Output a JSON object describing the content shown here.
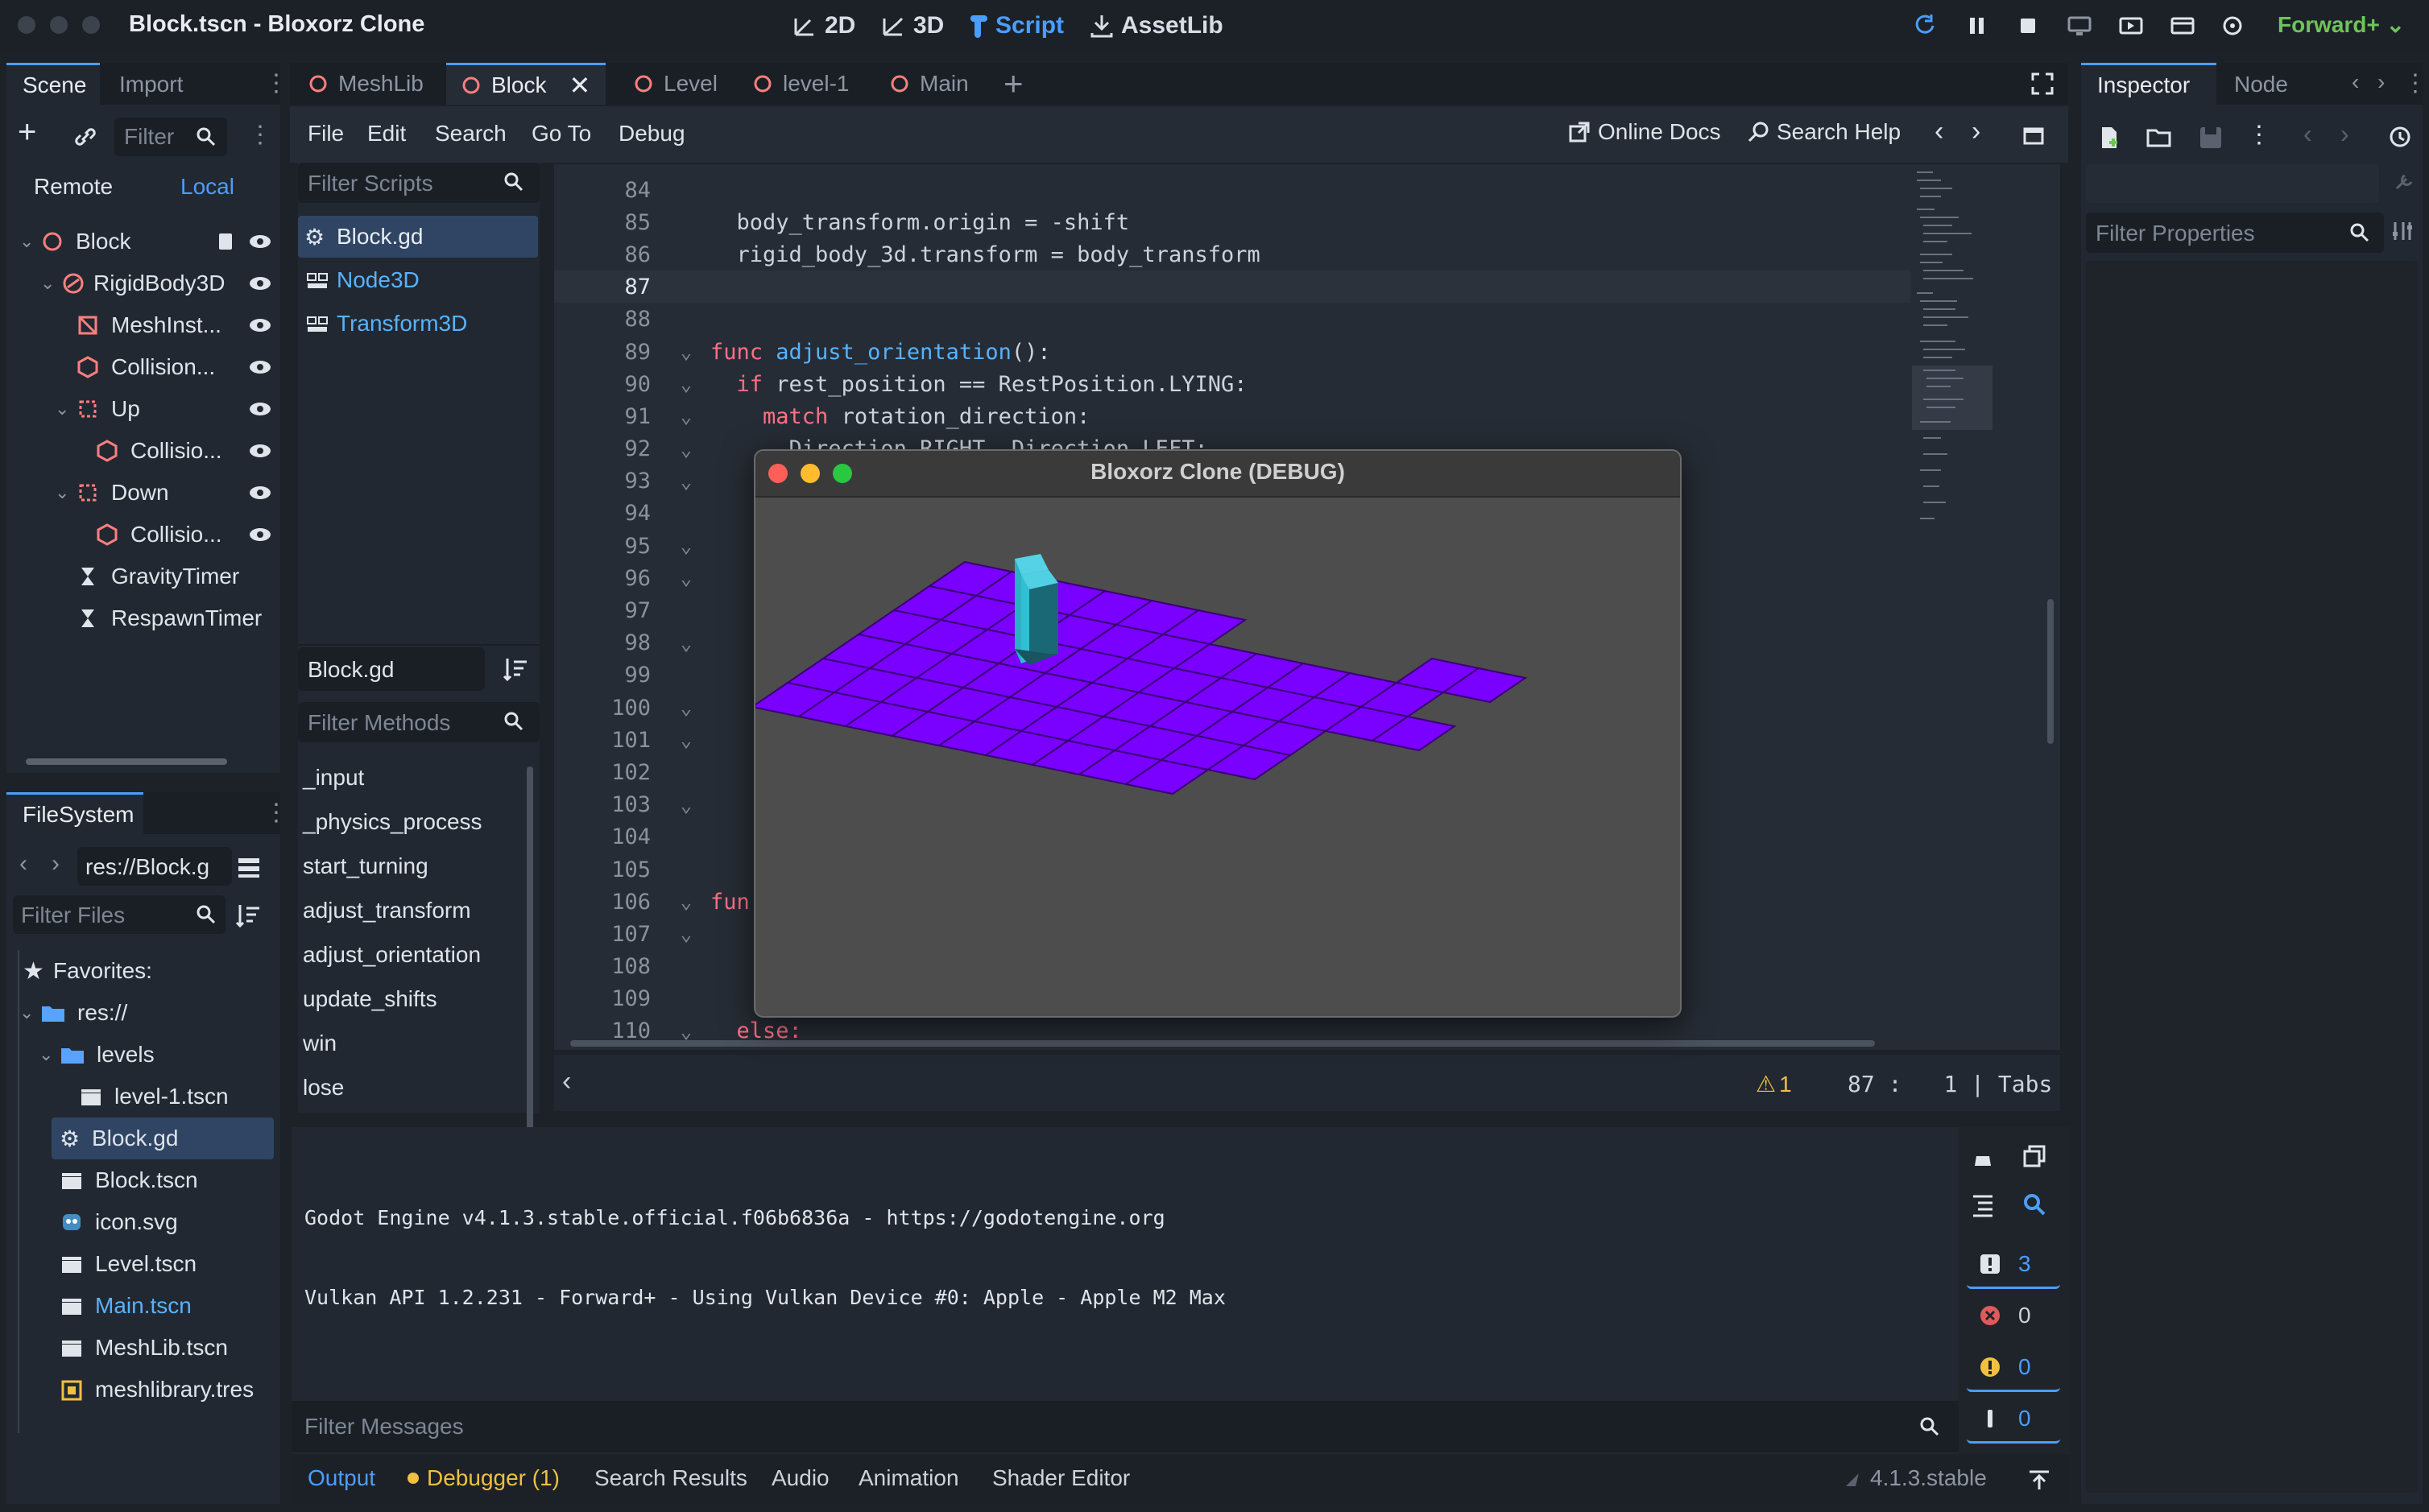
{
  "window": {
    "title": "Block.tscn - Bloxorz Clone"
  },
  "modes": [
    {
      "label": "2D",
      "icon": "2d-icon"
    },
    {
      "label": "3D",
      "icon": "3d-icon"
    },
    {
      "label": "Script",
      "icon": "script-icon"
    },
    {
      "label": "AssetLib",
      "icon": "assetlib-icon"
    }
  ],
  "renderer": "Forward+",
  "scene_dock": {
    "tabs": [
      "Scene",
      "Import"
    ],
    "filter_placeholder": "Filter",
    "remote": "Remote",
    "local": "Local",
    "nodes": [
      {
        "label": "Block",
        "depth": 0,
        "icon": "node3d-icon"
      },
      {
        "label": "RigidBody3D",
        "depth": 1,
        "icon": "rigidbody-icon"
      },
      {
        "label": "MeshInst...",
        "depth": 2,
        "icon": "mesh-icon"
      },
      {
        "label": "Collision...",
        "depth": 2,
        "icon": "collision-icon"
      },
      {
        "label": "Up",
        "depth": 2,
        "icon": "area-icon"
      },
      {
        "label": "Collisio...",
        "depth": 3,
        "icon": "collision-icon"
      },
      {
        "label": "Down",
        "depth": 2,
        "icon": "area-icon"
      },
      {
        "label": "Collisio...",
        "depth": 3,
        "icon": "collision-icon"
      },
      {
        "label": "GravityTimer",
        "depth": 1,
        "icon": "timer-icon"
      },
      {
        "label": "RespawnTimer",
        "depth": 1,
        "icon": "timer-icon"
      }
    ]
  },
  "filesystem": {
    "title": "FileSystem",
    "path": "res://Block.g",
    "filter_placeholder": "Filter Files",
    "items": [
      {
        "label": "Favorites:",
        "icon": "star-icon",
        "depth": 0
      },
      {
        "label": "res://",
        "icon": "folder-icon",
        "depth": 0
      },
      {
        "label": "levels",
        "icon": "folder-icon",
        "depth": 1
      },
      {
        "label": "level-1.tscn",
        "icon": "scene-icon",
        "depth": 2
      },
      {
        "label": "Block.gd",
        "icon": "gear-icon",
        "depth": 1,
        "selected": true
      },
      {
        "label": "Block.tscn",
        "icon": "scene-icon",
        "depth": 1
      },
      {
        "label": "icon.svg",
        "icon": "godot-icon",
        "depth": 1
      },
      {
        "label": "Level.tscn",
        "icon": "scene-icon",
        "depth": 1
      },
      {
        "label": "Main.tscn",
        "icon": "scene-icon",
        "depth": 1,
        "highlight": true
      },
      {
        "label": "MeshLib.tscn",
        "icon": "scene-icon",
        "depth": 1
      },
      {
        "label": "meshlibrary.tres",
        "icon": "resource-icon",
        "depth": 1
      }
    ]
  },
  "scene_tabs": [
    "MeshLib",
    "Block",
    "Level",
    "level-1",
    "Main"
  ],
  "script_menu": [
    "File",
    "Edit",
    "Search",
    "Go To",
    "Debug"
  ],
  "online_docs": "Online Docs",
  "search_help": "Search Help",
  "scripts_panel": {
    "filter_placeholder": "Filter Scripts",
    "scripts": [
      "Block.gd",
      "Node3D",
      "Transform3D"
    ],
    "current": "Block.gd",
    "methods_placeholder": "Filter Methods",
    "methods": [
      "_input",
      "_physics_process",
      "start_turning",
      "adjust_transform",
      "adjust_orientation",
      "update_shifts",
      "win",
      "lose"
    ]
  },
  "code": {
    "lines": [
      {
        "n": "84",
        "t": ""
      },
      {
        "n": "85",
        "t": "  body_transform.origin = -shift"
      },
      {
        "n": "86",
        "t": "  rigid_body_3d.transform = body_transform"
      },
      {
        "n": "87",
        "t": ""
      },
      {
        "n": "88",
        "t": ""
      },
      {
        "n": "89",
        "t": "func adjust_orientation():"
      },
      {
        "n": "90",
        "t": "  if rest_position == RestPosition.LYING:"
      },
      {
        "n": "91",
        "t": "    match rotation_direction:"
      },
      {
        "n": "92",
        "t": "      Direction.RIGHT, Direction.LEFT:"
      },
      {
        "n": "93",
        "t": ""
      },
      {
        "n": "94",
        "t": ""
      },
      {
        "n": "95",
        "t": ""
      },
      {
        "n": "96",
        "t": ""
      },
      {
        "n": "97",
        "t": ""
      },
      {
        "n": "98",
        "t": ""
      },
      {
        "n": "99",
        "t": ""
      },
      {
        "n": "100",
        "t": ""
      },
      {
        "n": "101",
        "t": ""
      },
      {
        "n": "102",
        "t": ""
      },
      {
        "n": "103",
        "t": ""
      },
      {
        "n": "104",
        "t": ""
      },
      {
        "n": "105",
        "t": ""
      },
      {
        "n": "106",
        "t": "fun"
      },
      {
        "n": "107",
        "t": ""
      },
      {
        "n": "108",
        "t": ""
      },
      {
        "n": "109",
        "t": ""
      },
      {
        "n": "110",
        "t": "  else:"
      }
    ],
    "status": {
      "warnings": "1",
      "line": "87",
      "col": "1",
      "indent": "Tabs"
    }
  },
  "game_window": {
    "title": "Bloxorz Clone (DEBUG)"
  },
  "output": {
    "lines": [
      "Godot Engine v4.1.3.stable.official.f06b6836a - https://godotengine.org",
      "Vulkan API 1.2.231 - Forward+ - Using Vulkan Device #0: Apple - Apple M2 Max"
    ],
    "filter_placeholder": "Filter Messages",
    "counters": {
      "messages": "3",
      "errors": "0",
      "warnings": "0",
      "editor": "0"
    }
  },
  "bottom_tabs": [
    "Output",
    "Debugger (1)",
    "Search Results",
    "Audio",
    "Animation",
    "Shader Editor"
  ],
  "version": "4.1.3.stable",
  "inspector": {
    "tabs": [
      "Inspector",
      "Node"
    ],
    "filter_placeholder": "Filter Properties"
  },
  "colors": {
    "accent": "#4a9eff",
    "tiles": "#7a00ff",
    "block": "#3fc1d6"
  }
}
